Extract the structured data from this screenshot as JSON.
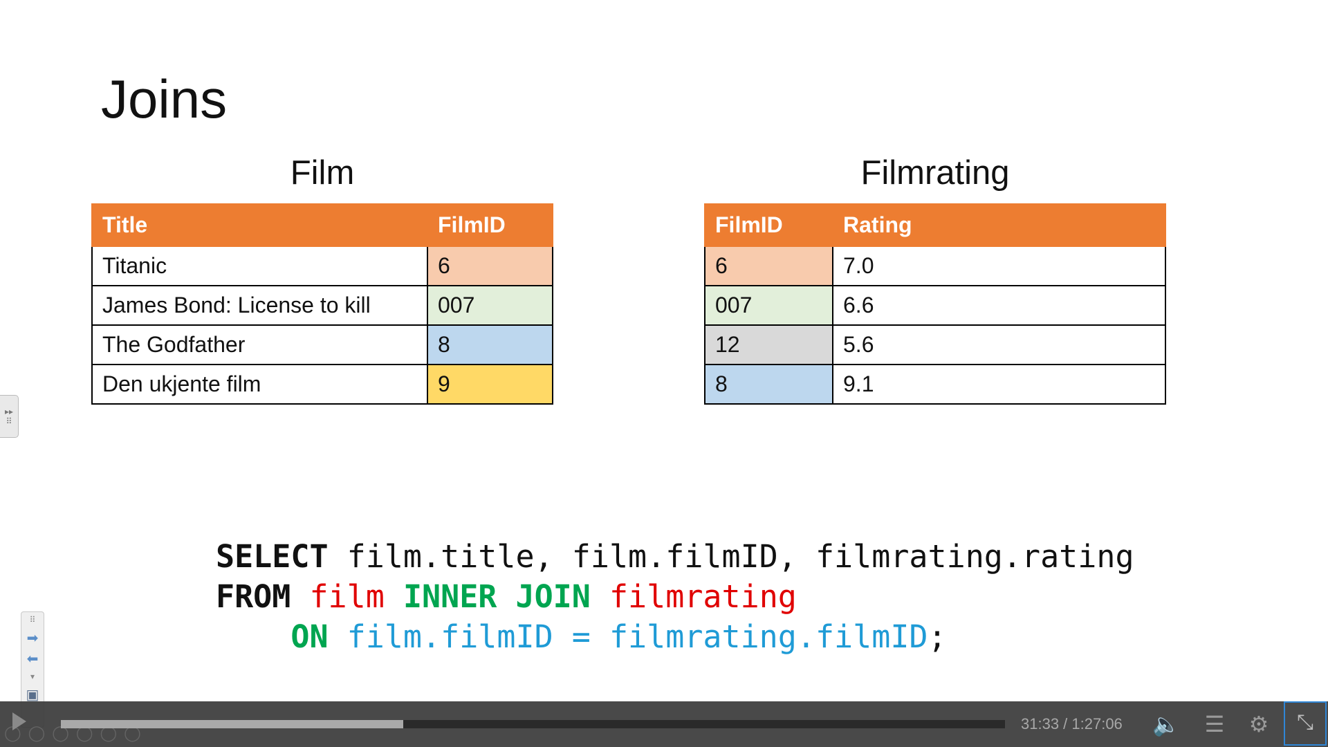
{
  "slide": {
    "title": "Joins",
    "film_table": {
      "caption": "Film",
      "headers": [
        "Title",
        "FilmID"
      ],
      "rows": [
        {
          "title": "Titanic",
          "filmid": "6",
          "color": "#f8cbad"
        },
        {
          "title": "James Bond: License to kill",
          "filmid": "007",
          "color": "#e2efda"
        },
        {
          "title": "The Godfather",
          "filmid": "8",
          "color": "#bdd7ee"
        },
        {
          "title": "Den ukjente film",
          "filmid": "9",
          "color": "#ffd966"
        }
      ]
    },
    "rating_table": {
      "caption": "Filmrating",
      "headers": [
        "FilmID",
        "Rating"
      ],
      "rows": [
        {
          "filmid": "6",
          "rating": "7.0",
          "color": "#f8cbad"
        },
        {
          "filmid": "007",
          "rating": "6.6",
          "color": "#e2efda"
        },
        {
          "filmid": "12",
          "rating": "5.6",
          "color": "#d9d9d9"
        },
        {
          "filmid": "8",
          "rating": "9.1",
          "color": "#bdd7ee"
        }
      ]
    },
    "sql": {
      "line1_kw": "SELECT",
      "line1_rest": " film.title, film.filmID, filmrating.rating",
      "line2_kw": "FROM",
      "line2_t1": "film",
      "line2_join": "INNER JOIN",
      "line2_t2": "filmrating",
      "line3_indent": "    ",
      "line3_kw": "ON",
      "line3_cond": "film.filmID = filmrating.filmID",
      "line3_end": ";"
    }
  },
  "player": {
    "timecode": "31:33 / 1:27:06",
    "progress": 0.3629,
    "icons": [
      "play-icon",
      "volume-icon",
      "chapters-list-icon",
      "settings-gear-icon",
      "exit-fullscreen-icon"
    ]
  },
  "colors": {
    "header_orange": "#ed7d31",
    "sql_red": "#e00000",
    "sql_green": "#00a550",
    "sql_blue": "#1f9bd6"
  }
}
